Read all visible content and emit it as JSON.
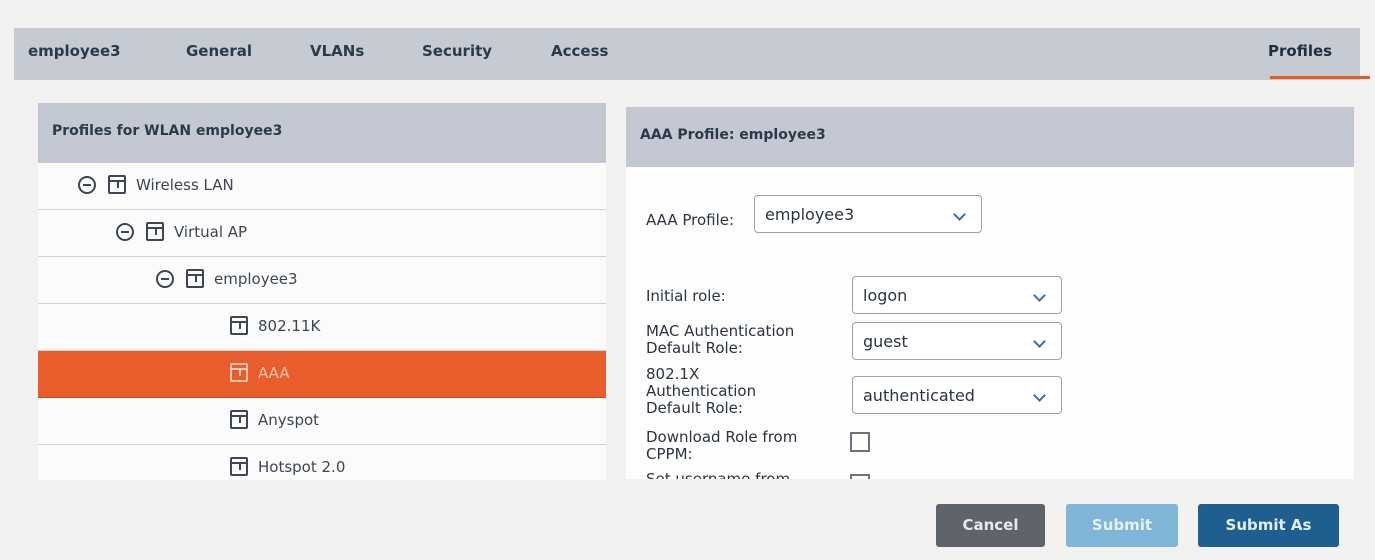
{
  "tabs": {
    "wlan": "employee3",
    "general": "General",
    "vlans": "VLANs",
    "security": "Security",
    "access": "Access",
    "profiles": "Profiles"
  },
  "left_panel": {
    "title": "Profiles for WLAN employee3",
    "tree": [
      {
        "label": "Wireless LAN",
        "level": 0,
        "expandable": true
      },
      {
        "label": "Virtual AP",
        "level": 1,
        "expandable": true
      },
      {
        "label": "employee3",
        "level": 2,
        "expandable": true
      },
      {
        "label": "802.11K",
        "level": 3,
        "expandable": false
      },
      {
        "label": "AAA",
        "level": 3,
        "expandable": false,
        "selected": true
      },
      {
        "label": "Anyspot",
        "level": 3,
        "expandable": false
      },
      {
        "label": "Hotspot 2.0",
        "level": 3,
        "expandable": false
      }
    ]
  },
  "right_panel": {
    "title": "AAA Profile: employee3",
    "aaa_profile_label": "AAA Profile:",
    "aaa_profile_value": "employee3",
    "initial_role_label": "Initial role:",
    "initial_role_value": "logon",
    "mac_auth_label_1": "MAC Authentication",
    "mac_auth_label_2": "Default Role:",
    "mac_auth_value": "guest",
    "dot1x_label_1": "802.1X",
    "dot1x_label_2": "Authentication",
    "dot1x_label_3": "Default Role:",
    "dot1x_value": "authenticated",
    "download_role_label_1": "Download Role from",
    "download_role_label_2": "CPPM:",
    "set_username_label": "Set username from"
  },
  "buttons": {
    "cancel": "Cancel",
    "submit": "Submit",
    "submit_as": "Submit As"
  },
  "colors": {
    "accent": "#e85d2b",
    "header_bg": "#c3c8d3",
    "cancel_bg": "#5f646b",
    "submit_bg": "#7fb6d8",
    "submit_as_bg": "#1e5f8f"
  }
}
